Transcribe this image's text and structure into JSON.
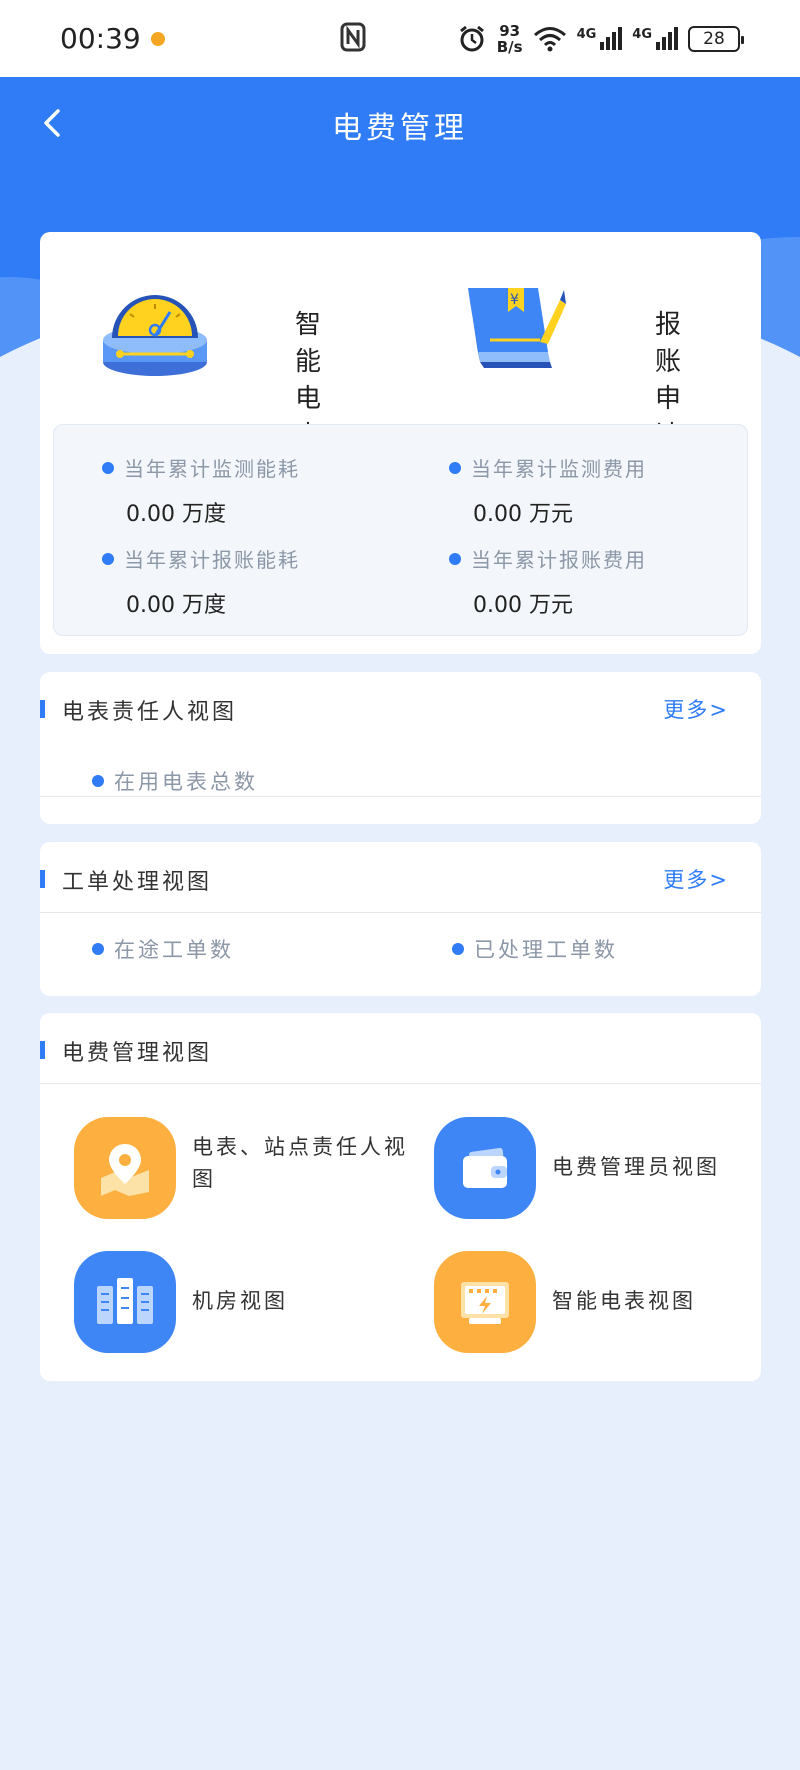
{
  "status": {
    "time": "00:39",
    "net_speed_value": "93",
    "net_speed_unit": "B/s",
    "signal1": "4G",
    "signal2": "4G",
    "battery": "28"
  },
  "header": {
    "title": "电费管理"
  },
  "summary": {
    "meter_label": "智能电表",
    "report_label": "报账申请",
    "stats": [
      {
        "label": "当年累计监测能耗",
        "value": "0.00 万度"
      },
      {
        "label": "当年累计监测费用",
        "value": "0.00 万元"
      },
      {
        "label": "当年累计报账能耗",
        "value": "0.00 万度"
      },
      {
        "label": "当年累计报账费用",
        "value": "0.00 万元"
      }
    ]
  },
  "meter_owner_view": {
    "title": "电表责任人视图",
    "more": "更多>",
    "items": [
      "在用电表总数"
    ]
  },
  "work_order_view": {
    "title": "工单处理视图",
    "more": "更多>",
    "items": [
      "在途工单数",
      "已处理工单数"
    ]
  },
  "fee_view": {
    "title": "电费管理视图",
    "tiles": [
      {
        "label": "电表、站点责任人视图",
        "icon": "map-pin-icon",
        "color": "#fdb03f"
      },
      {
        "label": "电费管理员视图",
        "icon": "wallet-icon",
        "color": "#3e85f5"
      },
      {
        "label": "机房视图",
        "icon": "server-rack-icon",
        "color": "#3e85f5"
      },
      {
        "label": "智能电表视图",
        "icon": "smart-meter-icon",
        "color": "#fdb03f"
      }
    ]
  }
}
